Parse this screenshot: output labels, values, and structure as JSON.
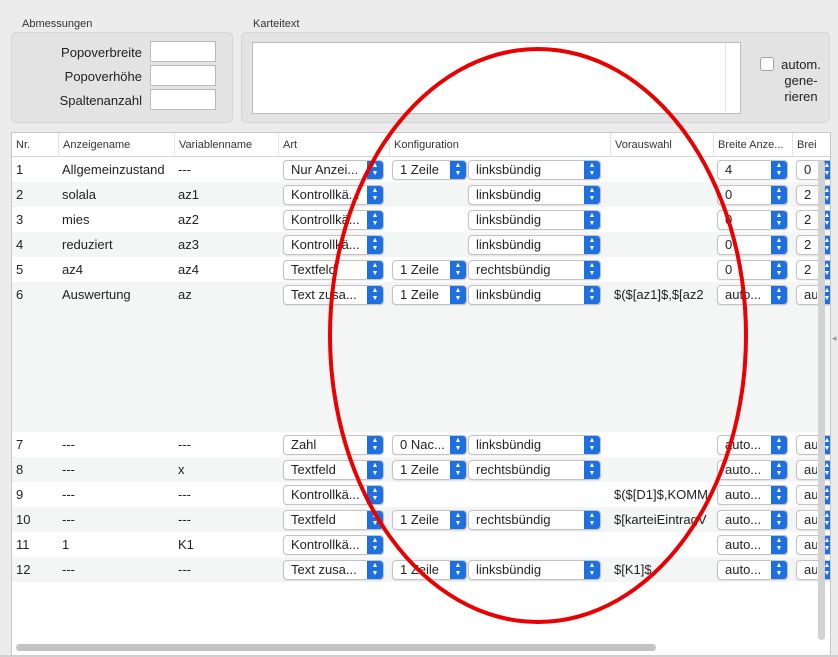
{
  "dimensions": {
    "group_label": "Abmessungen",
    "breite_label": "Popoverbreite",
    "breite_value": "",
    "hoehe_label": "Popoverhöhe",
    "hoehe_value": "",
    "spalten_label": "Spaltenanzahl",
    "spalten_value": ""
  },
  "karteitext": {
    "group_label": "Karteitext",
    "value": "",
    "auto_label": "autom. gene-rieren",
    "auto_checked": false
  },
  "table": {
    "headers": [
      "Nr.",
      "Anzeigename",
      "Variablenname",
      "Art",
      "Konfiguration",
      "Vorauswahl",
      "Breite Anze...",
      "Brei"
    ],
    "rows": [
      {
        "nr": "1",
        "anzeige": "Allgemeinzustand",
        "variable": "---",
        "art": "Nur Anzei...",
        "konf1": "1 Zeile",
        "konf2": "linksbündig",
        "vorauswahl": "",
        "breite": "4",
        "breite2": "0"
      },
      {
        "nr": "2",
        "anzeige": "solala",
        "variable": "az1",
        "art": "Kontrollkä...",
        "konf1": "",
        "konf2": "linksbündig",
        "vorauswahl": "",
        "breite": "0",
        "breite2": "2"
      },
      {
        "nr": "3",
        "anzeige": "mies",
        "variable": "az2",
        "art": "Kontrollkä...",
        "konf1": "",
        "konf2": "linksbündig",
        "vorauswahl": "",
        "breite": "0",
        "breite2": "2"
      },
      {
        "nr": "4",
        "anzeige": "reduziert",
        "variable": "az3",
        "art": "Kontrollkä...",
        "konf1": "",
        "konf2": "linksbündig",
        "vorauswahl": "",
        "breite": "0",
        "breite2": "2"
      },
      {
        "nr": "5",
        "anzeige": "az4",
        "variable": "az4",
        "art": "Textfeld",
        "konf1": "1 Zeile",
        "konf2": "rechtsbündig",
        "vorauswahl": "",
        "breite": "0",
        "breite2": "2"
      },
      {
        "nr": "6",
        "anzeige": "Auswertung",
        "variable": "az",
        "art": "Text zusa...",
        "konf1": "1 Zeile",
        "konf2": "linksbündig",
        "vorauswahl": "$($[az1]$,$[az2",
        "breite": "auto...",
        "breite2": "au"
      },
      {
        "nr": "7",
        "anzeige": "---",
        "variable": "---",
        "art": "Zahl",
        "konf1": "0 Nac...",
        "konf2": "linksbündig",
        "vorauswahl": "",
        "breite": "auto...",
        "breite2": "au"
      },
      {
        "nr": "8",
        "anzeige": "---",
        "variable": "x",
        "art": "Textfeld",
        "konf1": "1 Zeile",
        "konf2": "rechtsbündig",
        "vorauswahl": "",
        "breite": "auto...",
        "breite2": "au"
      },
      {
        "nr": "9",
        "anzeige": "---",
        "variable": "---",
        "art": "Kontrollkä...",
        "konf1": "",
        "konf2": "",
        "vorauswahl": "$($[D1]$,KOMM",
        "breite": "auto...",
        "breite2": "au"
      },
      {
        "nr": "10",
        "anzeige": "---",
        "variable": "---",
        "art": "Textfeld",
        "konf1": "1 Zeile",
        "konf2": "rechtsbündig",
        "vorauswahl": "$[karteiEintragV",
        "breite": "auto...",
        "breite2": "au"
      },
      {
        "nr": "11",
        "anzeige": "1",
        "variable": "K1",
        "art": "Kontrollkä...",
        "konf1": "",
        "konf2": "",
        "vorauswahl": "",
        "breite": "auto...",
        "breite2": "au"
      },
      {
        "nr": "12",
        "anzeige": "---",
        "variable": "---",
        "art": "Text zusa...",
        "konf1": "1 Zeile",
        "konf2": "linksbündig",
        "vorauswahl": "$[K1]$",
        "breite": "auto...",
        "breite2": "au"
      }
    ]
  },
  "colors": {
    "accent": "#1e6fe0",
    "annotation": "#ea0000"
  }
}
